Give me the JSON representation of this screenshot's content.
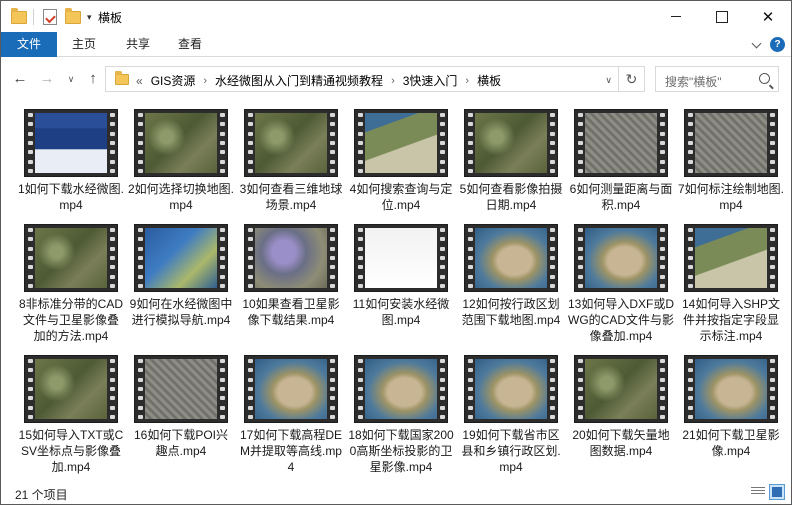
{
  "window": {
    "title": "横板",
    "qa_dropdown": "▾",
    "minimize": "",
    "maximize": "",
    "close": "✕"
  },
  "ribbon": {
    "tabs": [
      "文件",
      "主页",
      "共享",
      "查看"
    ],
    "help": "?"
  },
  "nav": {
    "back": "←",
    "forward": "→",
    "recent": "∨",
    "up": "↑"
  },
  "address": {
    "overflow": "«",
    "crumbs": [
      "GIS资源",
      "水经微图从入门到精通视频教程",
      "3快速入门",
      "横板"
    ],
    "separator": "›",
    "dropdown": "∨",
    "refresh": "↻"
  },
  "search": {
    "placeholder": "搜索\"横板\""
  },
  "files": [
    {
      "name": "1如何下载水经微图.mp4",
      "thumb": "app"
    },
    {
      "name": "2如何选择切换地图.mp4",
      "thumb": "sat"
    },
    {
      "name": "3如何查看三维地球场景.mp4",
      "thumb": "sat"
    },
    {
      "name": "4如何搜索查询与定位.mp4",
      "thumb": "map"
    },
    {
      "name": "5如何查看影像拍摄日期.mp4",
      "thumb": "sat"
    },
    {
      "name": "6如何测量距离与面积.mp4",
      "thumb": "city"
    },
    {
      "name": "7如何标注绘制地图.mp4",
      "thumb": "city"
    },
    {
      "name": "8非标准分带的CAD文件与卫星影像叠加的方法.mp4",
      "thumb": "sat"
    },
    {
      "name": "9如何在水经微图中进行模拟导航.mp4",
      "thumb": "blue"
    },
    {
      "name": "10如果查看卫星影像下载结果.mp4",
      "thumb": "purple"
    },
    {
      "name": "11如何安装水经微图.mp4",
      "thumb": "white"
    },
    {
      "name": "12如何按行政区划范围下载地图.mp4",
      "thumb": "china"
    },
    {
      "name": "13如何导入DXF或DWG的CAD文件与影像叠加.mp4",
      "thumb": "china"
    },
    {
      "name": "14如何导入SHP文件并按指定字段显示标注.mp4",
      "thumb": "map"
    },
    {
      "name": "15如何导入TXT或CSV坐标点与影像叠加.mp4",
      "thumb": "sat"
    },
    {
      "name": "16如何下载POI兴趣点.mp4",
      "thumb": "city"
    },
    {
      "name": "17如何下载高程DEM并提取等高线.mp4",
      "thumb": "china"
    },
    {
      "name": "18如何下载国家2000高斯坐标投影的卫星影像.mp4",
      "thumb": "china"
    },
    {
      "name": "19如何下载省市区县和乡镇行政区划.mp4",
      "thumb": "china"
    },
    {
      "name": "20如何下载矢量地图数据.mp4",
      "thumb": "sat"
    },
    {
      "name": "21如何下载卫星影像.mp4",
      "thumb": "china"
    }
  ],
  "status": {
    "count": "21 个项目"
  }
}
